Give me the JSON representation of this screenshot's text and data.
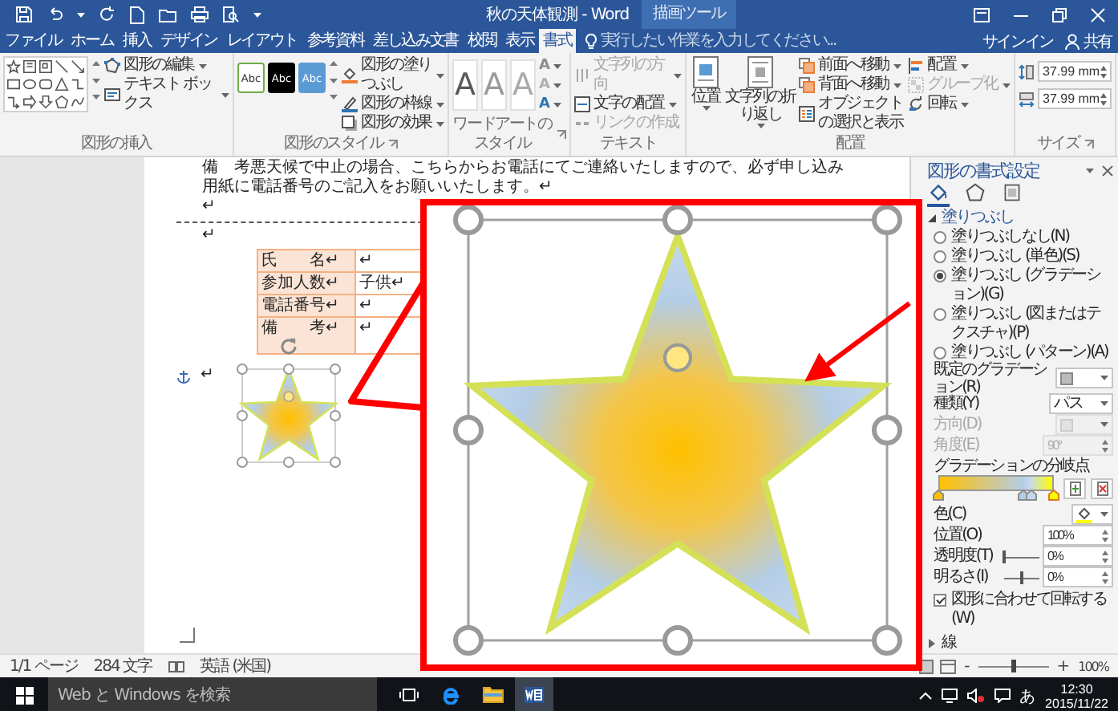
{
  "window": {
    "title": "秋の天体観測 - Word",
    "context_label": "描画ツール",
    "sign_in": "サインイン",
    "share": "共有"
  },
  "tabs": [
    {
      "label": "ファイル",
      "selected": false
    },
    {
      "label": "ホーム",
      "selected": false
    },
    {
      "label": "挿入",
      "selected": false
    },
    {
      "label": "デザイン",
      "selected": false
    },
    {
      "label": "レイアウト",
      "selected": false
    },
    {
      "label": "参考資料",
      "selected": false
    },
    {
      "label": "差し込み文書",
      "selected": false
    },
    {
      "label": "校閲",
      "selected": false
    },
    {
      "label": "表示",
      "selected": false
    },
    {
      "label": "書式",
      "selected": true
    }
  ],
  "tell_me": {
    "placeholder": "実行したい作業を入力してください..."
  },
  "ribbon": {
    "groups": [
      {
        "kind": "insert-shapes",
        "label": "図形の挿入",
        "commands": [
          {
            "label": "図形の編集",
            "disabled": false
          },
          {
            "label": "テキスト ボックス",
            "disabled": false
          }
        ]
      },
      {
        "kind": "shape-styles",
        "label": "図形のスタイル",
        "swatches": [
          {
            "label": "Abc",
            "color": "#ffffff"
          },
          {
            "label": "Abc",
            "color": "#000000"
          },
          {
            "label": "Abc",
            "color": "#5b9bd5"
          }
        ],
        "commands": [
          {
            "label": "図形の塗りつぶし",
            "disabled": false
          },
          {
            "label": "図形の枠線",
            "disabled": false
          },
          {
            "label": "図形の効果",
            "disabled": false
          }
        ]
      },
      {
        "kind": "wordart",
        "label": "ワードアートのスタイル",
        "samples": [
          {
            "label": "A",
            "color": "#595959"
          },
          {
            "label": "A",
            "color": "#9a9a9a"
          },
          {
            "label": "A",
            "color": "#ababab"
          }
        ],
        "tools": [
          {
            "label": "A",
            "color": "#8c8c8c"
          },
          {
            "label": "A",
            "color": "#b0b0b0"
          },
          {
            "label": "A",
            "color": "#2e75b6"
          }
        ]
      },
      {
        "kind": "text",
        "label": "テキスト",
        "commands": [
          {
            "label": "文字列の方向",
            "disabled": true
          },
          {
            "label": "文字の配置",
            "disabled": false
          },
          {
            "label": "リンクの作成",
            "disabled": true
          }
        ]
      },
      {
        "kind": "arrange",
        "label": "配置",
        "large": [
          {
            "label": "位置"
          },
          {
            "label": "文字列の折り返し"
          }
        ],
        "commands": [
          {
            "label": "前面へ移動",
            "disabled": false
          },
          {
            "label": "背面へ移動",
            "disabled": false
          },
          {
            "label": "オブジェクトの選択と表示",
            "disabled": false
          },
          {
            "label": "配置",
            "disabled": false
          },
          {
            "label": "グループ化",
            "disabled": true
          },
          {
            "label": "回転",
            "disabled": false
          }
        ]
      },
      {
        "kind": "size",
        "label": "サイズ",
        "fields": [
          {
            "value": "37.99 mm"
          },
          {
            "value": "37.99 mm"
          }
        ]
      }
    ]
  },
  "document": {
    "lines": [
      "備　考悪天候で中止の場合、こちらからお電話にてご連絡いたしますので、必ず申し込み",
      "用紙に電話番号のご記入をお願いいたします。↵",
      "↵"
    ],
    "after_rule_mark": "↵",
    "table": [
      {
        "label": "氏　　名↵",
        "value": "↵"
      },
      {
        "label": "参加人数↵",
        "value": "子供↵"
      },
      {
        "label": "電話番号↵",
        "value": "↵"
      },
      {
        "label": "備　　考↵",
        "value": "↵"
      }
    ],
    "shape_mark": "↵"
  },
  "pane": {
    "title": "図形の書式設定",
    "icon_tabs": [
      {
        "selected": true
      },
      {
        "selected": false
      },
      {
        "selected": false
      }
    ],
    "fill": {
      "title": "塗りつぶし",
      "expanded": true,
      "options": [
        {
          "label": "塗りつぶしなし(N)",
          "selected": false
        },
        {
          "label": "塗りつぶし (単色)(S)",
          "selected": false
        },
        {
          "label": "塗りつぶし (グラデーション)(G)",
          "selected": true
        },
        {
          "label": "塗りつぶし (図またはテクスチャ)(P)",
          "selected": false
        },
        {
          "label": "塗りつぶし (パターン)(A)",
          "selected": false
        }
      ],
      "fields": [
        {
          "kind": "swatch",
          "label": "既定のグラデーション(R)",
          "disabled": false
        },
        {
          "kind": "dropdown",
          "label": "種類(Y)",
          "value": "パス",
          "disabled": false
        },
        {
          "kind": "swatch",
          "label": "方向(D)",
          "disabled": true
        },
        {
          "kind": "spin",
          "label": "角度(E)",
          "value": "90°",
          "disabled": true
        },
        {
          "kind": "stops",
          "label": "グラデーションの分岐点",
          "disabled": false,
          "stops": [
            {
              "level": 0,
              "color": "#ffc000",
              "selected": false
            },
            {
              "level": 0.74,
              "color": "#b4cde6",
              "selected": false
            },
            {
              "level": 0.8,
              "color": "#c5d9ee",
              "selected": false
            },
            {
              "level": 1,
              "color": "#ffff00",
              "selected": true
            }
          ]
        },
        {
          "kind": "color",
          "label": "色(C)",
          "disabled": false
        },
        {
          "kind": "spin",
          "label": "位置(O)",
          "value": "100%",
          "disabled": false
        },
        {
          "kind": "slider",
          "label": "透明度(T)",
          "value": "0%",
          "level": 0,
          "disabled": false
        },
        {
          "kind": "slider",
          "label": "明るさ(I)",
          "value": "0%",
          "level": 0.5,
          "disabled": false
        }
      ],
      "rotate_with_shape": {
        "label": "図形に合わせて回転する(W)",
        "checked": true
      }
    },
    "line": {
      "title": "線",
      "expanded": false
    }
  },
  "status_bar": {
    "page": "1/1 ページ",
    "words": "284 文字",
    "language": "英語 (米国)",
    "zoom_out": "-",
    "zoom_slider": {
      "level": 0.5
    },
    "zoom_in": "+",
    "zoom": "100%"
  },
  "taskbar": {
    "search": {
      "placeholder": "Web と Windows を検索"
    },
    "apps": [
      {
        "kind": "browser",
        "selected": false
      },
      {
        "kind": "folder",
        "selected": false
      },
      {
        "kind": "document",
        "selected": true
      }
    ],
    "ime": "あ",
    "time": "12:30",
    "date": "2015/11/22"
  }
}
